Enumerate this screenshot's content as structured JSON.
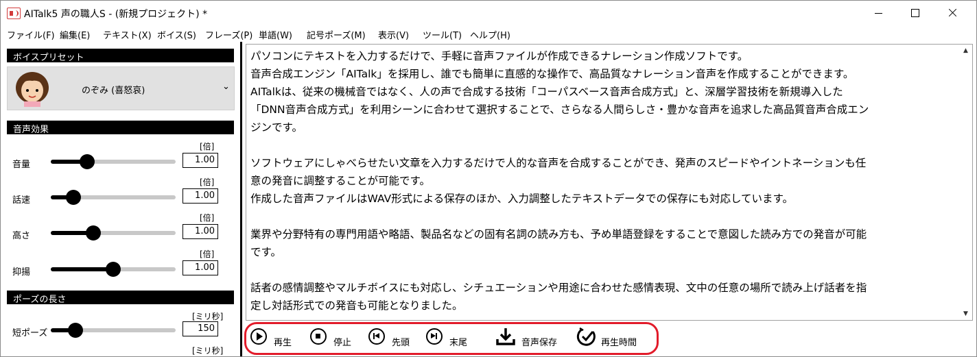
{
  "window": {
    "title": "AITalk5 声の職人S - (新規プロジェクト) *"
  },
  "menu": [
    "ファイル(F)",
    "編集(E)",
    "テキスト(X)",
    "ボイス(S)",
    "フレーズ(P)",
    "単語(W)",
    "記号ポーズ(M)",
    "表示(V)",
    "ツール(T)",
    "ヘルプ(H)"
  ],
  "voice_preset": {
    "header": "ボイスプリセット",
    "selected": "のぞみ (喜怒哀)",
    "chevron_icon": "chevron-down-icon"
  },
  "voice_effects": {
    "header": "音声効果",
    "sliders": [
      {
        "label": "音量",
        "unit": "[倍]",
        "value": "1.00",
        "level": 0.29
      },
      {
        "label": "話速",
        "unit": "[倍]",
        "value": "1.00",
        "level": 0.18
      },
      {
        "label": "高さ",
        "unit": "[倍]",
        "value": "1.00",
        "level": 0.34
      },
      {
        "label": "抑揚",
        "unit": "[倍]",
        "value": "1.00",
        "level": 0.5
      }
    ]
  },
  "pause_length": {
    "header": "ポーズの長さ",
    "sliders": [
      {
        "label": "短ポーズ",
        "unit": "[ミリ秒]",
        "value": "150",
        "level": 0.2
      }
    ],
    "next_unit": "[ミリ秒]"
  },
  "text_lines": [
    "パソコンにテキストを入力するだけで、手軽に音声ファイルが作成できるナレーション作成ソフトです。",
    "音声合成エンジン「AITalk」を採用し、誰でも簡単に直感的な操作で、高品質なナレーション音声を作成することができます。",
    "AITalkは、従来の機械音ではなく、人の声で合成する技術「コーパスベース音声合成方式」と、深層学習技術を新規導入した",
    "「DNN音声合成方式」を利用シーンに合わせて選択することで、さらなる人間らしさ・豊かな音声を追求した高品質音声合成エン",
    "ジンです。",
    "",
    "ソフトウェアにしゃべらせたい文章を入力するだけで人的な音声を合成することができ、発声のスピードやイントネーションも任",
    "意の発音に調整することが可能です。",
    "作成した音声ファイルはWAV形式による保存のほか、入力調整したテキストデータでの保存にも対応しています。",
    "",
    "業界や分野特有の専門用語や略語、製品名などの固有名詞の読み方も、予め単語登録をすることで意図した読み方での発音が可能",
    "です。",
    "",
    "話者の感情調整やマルチボイスにも対応し、シチュエーションや用途に合わせた感情表現、文中の任意の場所で読み上げ話者を指",
    "定し対話形式での発音も可能となりました。"
  ],
  "toolbar": {
    "play": {
      "label": "再生",
      "icon": "play-icon"
    },
    "stop": {
      "label": "停止",
      "icon": "stop-icon"
    },
    "start": {
      "label": "先頭",
      "icon": "skip-start-icon"
    },
    "end": {
      "label": "末尾",
      "icon": "skip-end-icon"
    },
    "save": {
      "label": "音声保存",
      "icon": "download-icon"
    },
    "duration": {
      "label": "再生時間",
      "icon": "clock-check-icon"
    },
    "highlight_color": "#e21b2a"
  }
}
